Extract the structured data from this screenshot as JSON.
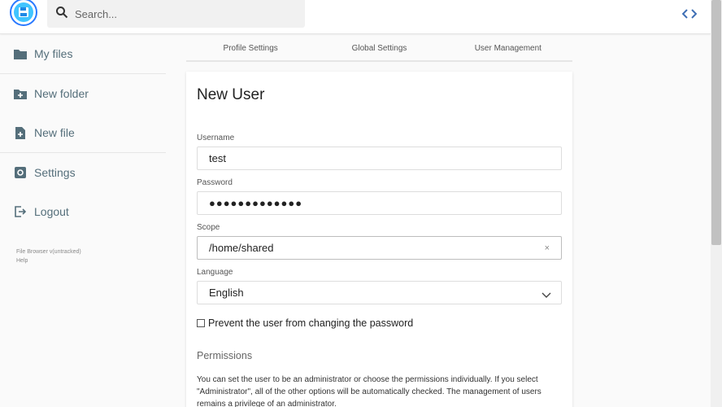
{
  "header": {
    "search_placeholder": "Search..."
  },
  "sidebar": {
    "items": [
      {
        "label": "My files",
        "icon": "folder-icon"
      },
      {
        "label": "New folder",
        "icon": "new-folder-icon"
      },
      {
        "label": "New file",
        "icon": "new-file-icon"
      },
      {
        "label": "Settings",
        "icon": "settings-icon"
      },
      {
        "label": "Logout",
        "icon": "logout-icon"
      }
    ],
    "credits": {
      "version": "File Browser v(untracked)",
      "help": "Help"
    }
  },
  "tabs": [
    "Profile Settings",
    "Global Settings",
    "User Management"
  ],
  "form": {
    "title": "New User",
    "username_label": "Username",
    "username_value": "test",
    "password_label": "Password",
    "password_value": "●●●●●●●●●●●●●",
    "scope_label": "Scope",
    "scope_value": "/home/shared",
    "clear_symbol": "×",
    "language_label": "Language",
    "language_value": "English",
    "checkbox_label": "Prevent the user from changing the password",
    "checkbox_checked": false,
    "permissions_title": "Permissions",
    "permissions_desc": "You can set the user to be an administrator or choose the permissions individually. If you select \"Administrator\", all of the other options will be automatically checked. The management of users remains a privilege of an administrator."
  },
  "colors": {
    "accent": "#2979ff",
    "logo_fill": "#40c4ff",
    "sidebar_text": "#546e7a"
  }
}
